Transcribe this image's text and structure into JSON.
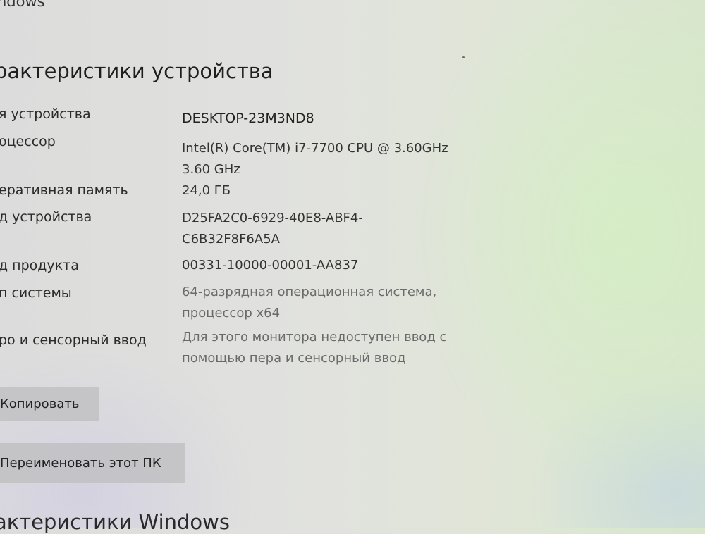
{
  "header": {
    "top_title": "ndows",
    "section_title": "рактеристики устройства"
  },
  "specs": [
    {
      "label": "я устройства",
      "value": "DESKTOP-23M3ND8"
    },
    {
      "label": "оцессор",
      "value": "Intel(R) Core(TM) i7-7700 CPU @ 3.60GHz 3.60 GHz"
    },
    {
      "label": "еративная память",
      "value": "24,0 ГБ"
    },
    {
      "label": "д устройства",
      "value": "D25FA2C0-6929-40E8-ABF4-C6B32F8F6A5A"
    },
    {
      "label": "д продукта",
      "value": "00331-10000-00001-AA837"
    },
    {
      "label": "п системы",
      "value": "64-разрядная операционная система, процессор x64"
    },
    {
      "label": "ро и сенсорный ввод",
      "value": "Для этого монитора недоступен ввод с помощью пера и сенсорный ввод"
    }
  ],
  "buttons": {
    "copy_label": "Копировать",
    "rename_label": "Переименовать этот ПК"
  },
  "footer": {
    "bottom_title": "актеристики Windows"
  }
}
